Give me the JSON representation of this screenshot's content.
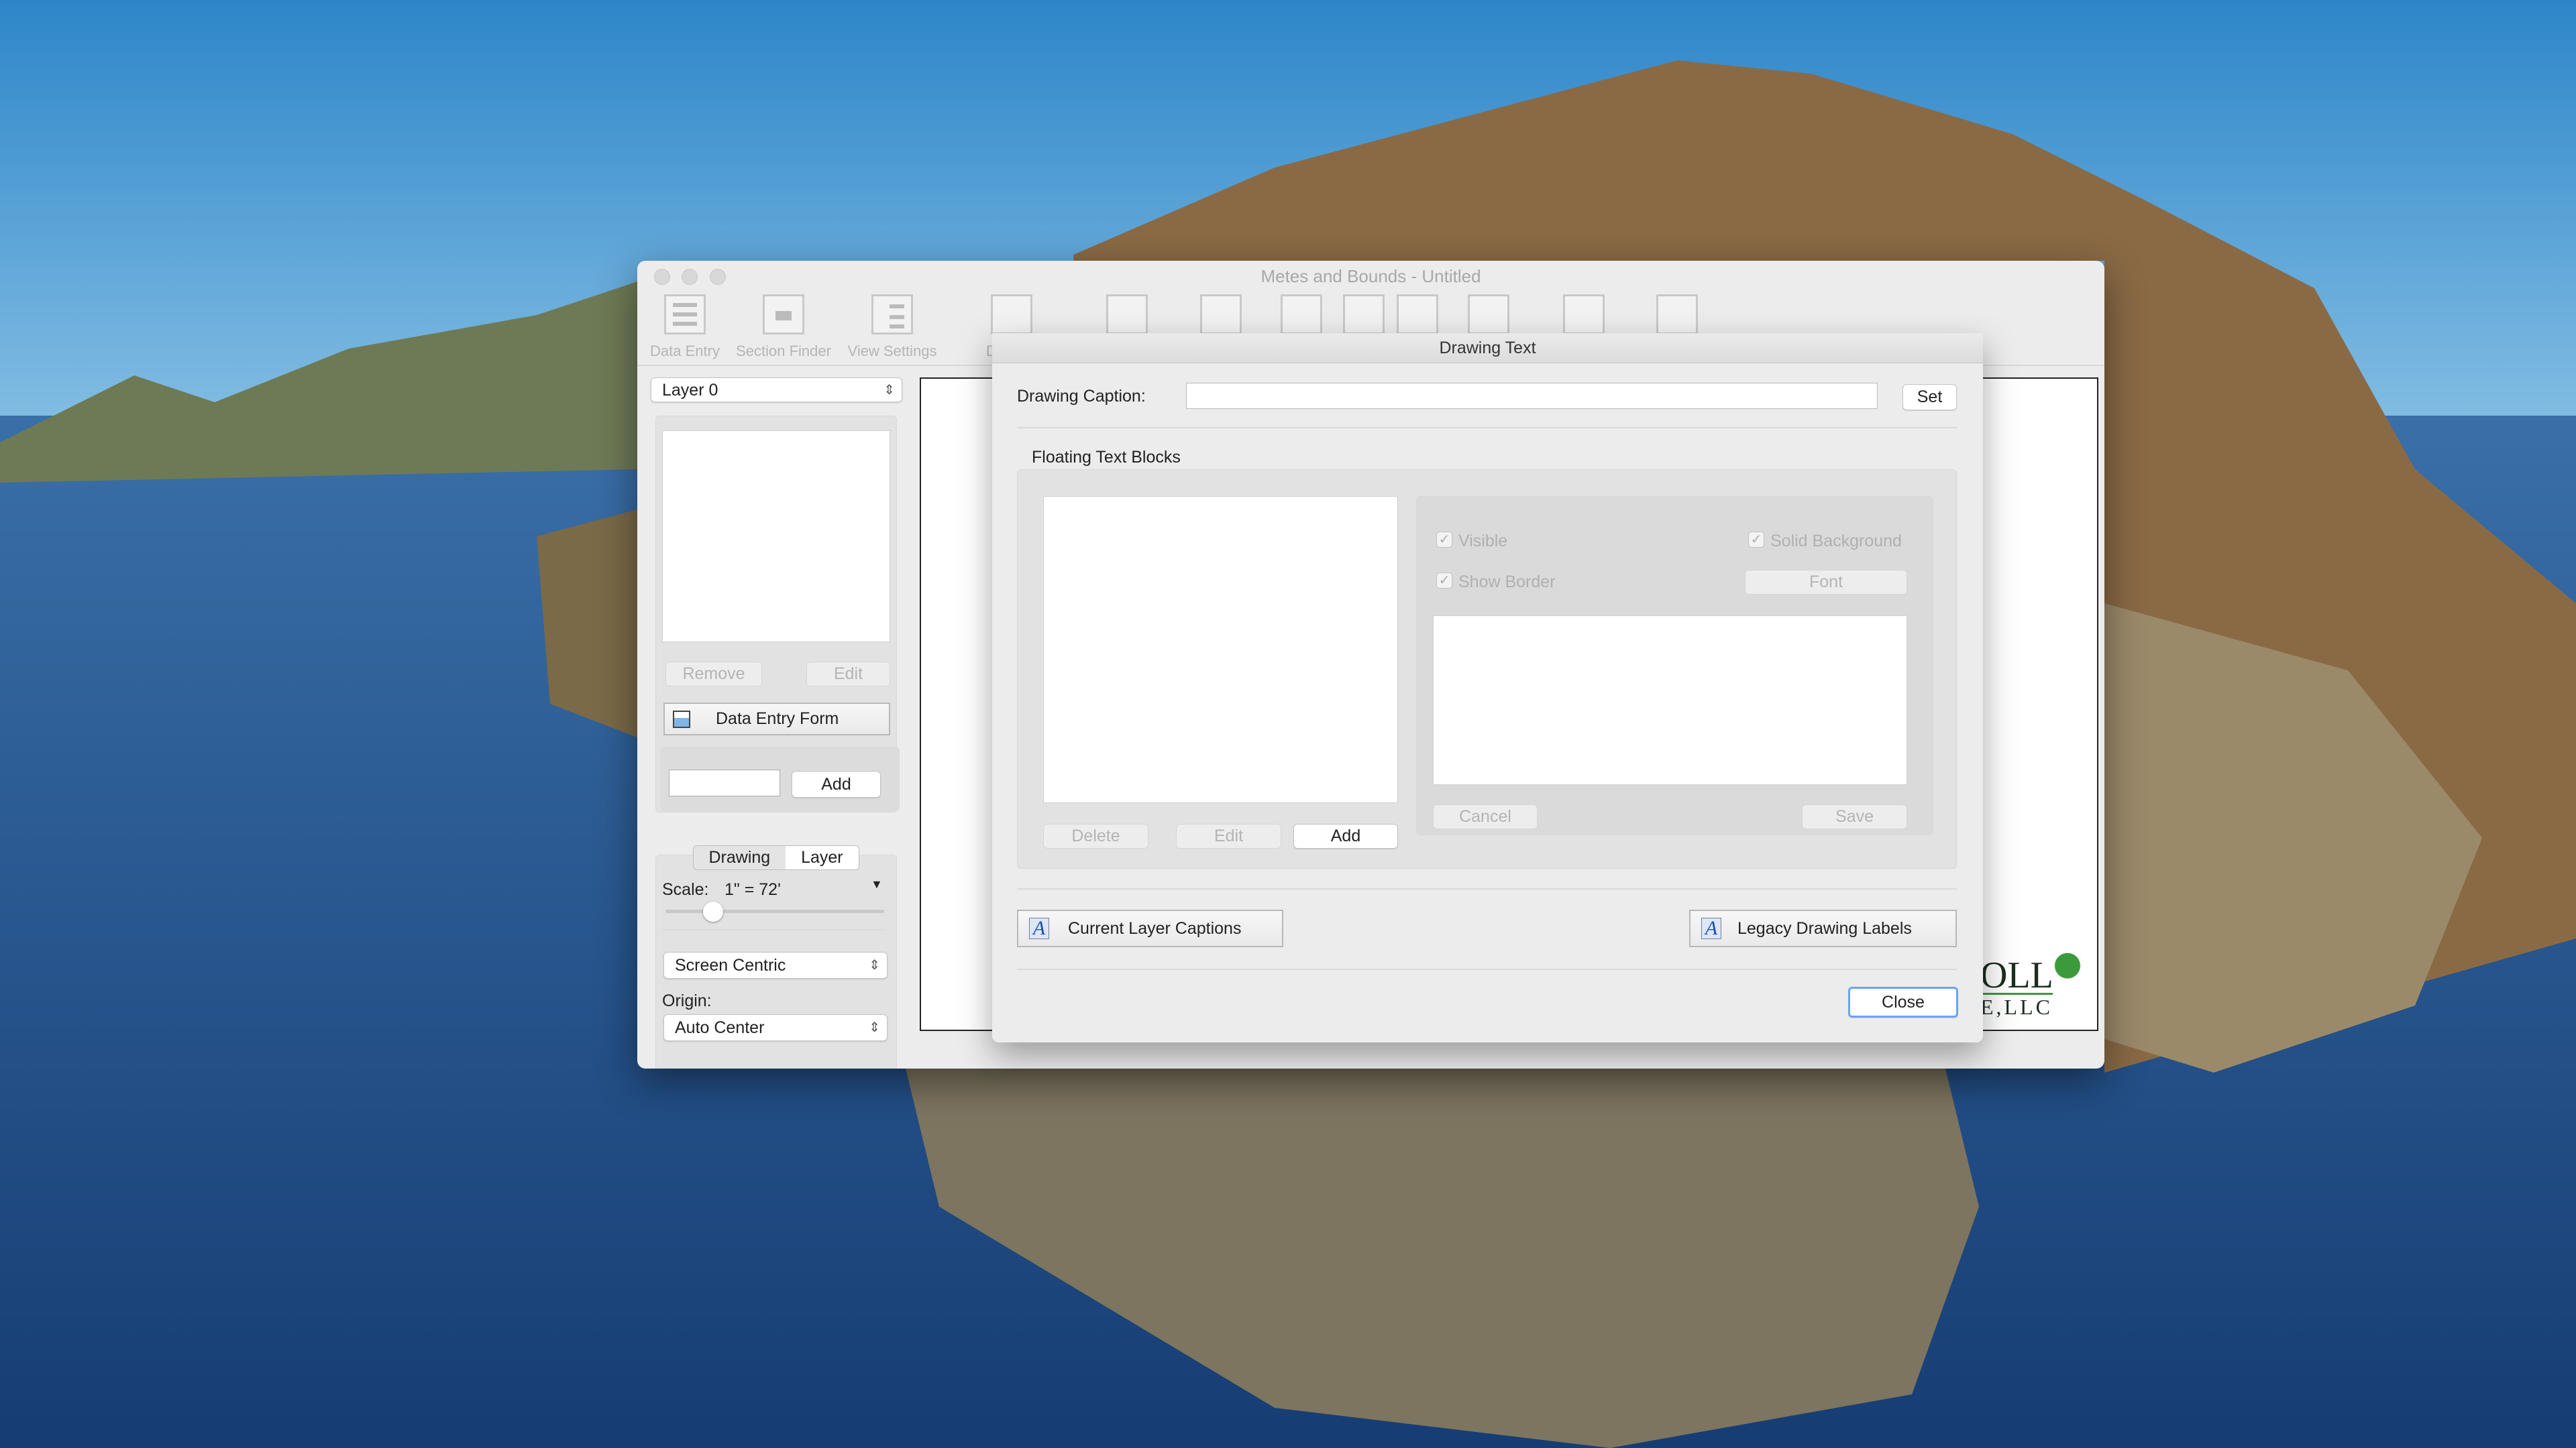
{
  "main_window": {
    "title": "Metes and Bounds - Untitled",
    "toolbar": [
      {
        "label": "Data Entry",
        "icon": "data-entry-icon"
      },
      {
        "label": "Section Finder",
        "icon": "section-finder-icon"
      },
      {
        "label": "View Settings",
        "icon": "view-settings-icon"
      },
      {
        "label": "Draw",
        "icon": "drawing-icon"
      }
    ],
    "sidebar": {
      "layer_select": "Layer 0",
      "remove_label": "Remove",
      "edit_label": "Edit",
      "data_entry_form_label": "Data Entry Form",
      "add_input_value": "",
      "add_label": "Add",
      "segment_drawing": "Drawing",
      "segment_layer": "Layer",
      "segment_selected": "Layer",
      "scale_label": "Scale:",
      "scale_value": "1\" = 72'",
      "view_mode_select": "Screen Centric",
      "origin_label": "Origin:",
      "origin_select": "Auto Center"
    },
    "canvas_logo": {
      "line1": "OLL",
      "line2": "E,LLC"
    }
  },
  "dialog": {
    "title": "Drawing Text",
    "caption_label": "Drawing Caption:",
    "caption_value": "",
    "set_label": "Set",
    "floating_title": "Floating Text Blocks",
    "delete_label": "Delete",
    "edit_label": "Edit",
    "add_label": "Add",
    "visible_label": "Visible",
    "visible_checked": true,
    "solid_bg_label": "Solid Background",
    "solid_bg_checked": true,
    "show_border_label": "Show Border",
    "show_border_checked": true,
    "font_label": "Font",
    "cancel_label": "Cancel",
    "save_label": "Save",
    "current_layer_captions_label": "Current Layer Captions",
    "legacy_labels_label": "Legacy Drawing Labels",
    "close_label": "Close"
  },
  "colors": {
    "accent": "#2f7bf5",
    "window_bg": "#ececec",
    "caption_icon": "#1e4fb4"
  }
}
